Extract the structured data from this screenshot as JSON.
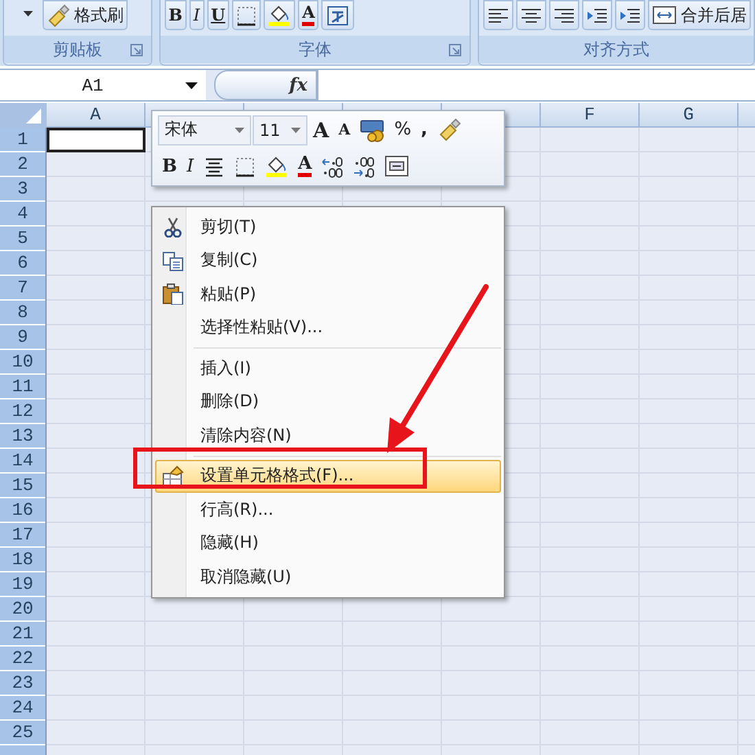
{
  "ribbon": {
    "groups": [
      {
        "label": "剪贴板",
        "buttons": [
          {
            "kind": "caret"
          },
          {
            "kind": "painter",
            "text": "格式刷"
          }
        ]
      },
      {
        "label": "字体",
        "buttons": [
          {
            "kind": "bold",
            "text": "B"
          },
          {
            "kind": "italic",
            "text": "I"
          },
          {
            "kind": "underline",
            "text": "U"
          },
          {
            "kind": "border"
          },
          {
            "kind": "fill"
          },
          {
            "kind": "fontcolor",
            "text": "A"
          },
          {
            "kind": "phonetic"
          }
        ]
      },
      {
        "label": "对齐方式",
        "buttons": [
          {
            "kind": "align_left"
          },
          {
            "kind": "align_center"
          },
          {
            "kind": "align_right"
          },
          {
            "kind": "outdent"
          },
          {
            "kind": "indent"
          },
          {
            "kind": "merge",
            "text": "合并后居"
          }
        ]
      }
    ]
  },
  "formula_bar": {
    "name_box": "A1",
    "function_label": "fx"
  },
  "sheet": {
    "columns": [
      "A",
      null,
      null,
      null,
      null,
      "F",
      "G"
    ],
    "rows": [
      {
        "label": "1",
        "active": true
      },
      {
        "label": "2",
        "active": false
      },
      {
        "label": "3",
        "active": false
      },
      {
        "label": "4",
        "active": false
      },
      {
        "label": "5",
        "active": false
      },
      {
        "label": "6",
        "active": false
      },
      {
        "label": "7",
        "active": false
      },
      {
        "label": "8",
        "active": false
      },
      {
        "label": "9",
        "active": false
      },
      {
        "label": "10",
        "active": false
      },
      {
        "label": "11",
        "active": false
      },
      {
        "label": "12",
        "active": false
      },
      {
        "label": "13",
        "active": false
      },
      {
        "label": "14",
        "active": false
      },
      {
        "label": "15",
        "active": false
      },
      {
        "label": "16",
        "active": false
      },
      {
        "label": "17",
        "active": false
      },
      {
        "label": "18",
        "active": false
      },
      {
        "label": "19",
        "active": false
      },
      {
        "label": "20",
        "active": false
      },
      {
        "label": "21",
        "active": false
      },
      {
        "label": "22",
        "active": false
      },
      {
        "label": "23",
        "active": false
      },
      {
        "label": "24",
        "active": false
      },
      {
        "label": "25",
        "active": false
      }
    ]
  },
  "mini_toolbar": {
    "font": "宋体",
    "size": "11",
    "row1": [
      {
        "kind": "grow",
        "text": "A"
      },
      {
        "kind": "shrink",
        "text": "A"
      },
      {
        "kind": "accounting"
      },
      {
        "kind": "percent",
        "text": "%"
      },
      {
        "kind": "comma",
        "text": ","
      },
      {
        "kind": "painter"
      }
    ],
    "row2": [
      {
        "kind": "bold",
        "text": "B"
      },
      {
        "kind": "italic",
        "text": "I"
      },
      {
        "kind": "center"
      },
      {
        "kind": "border"
      },
      {
        "kind": "fill"
      },
      {
        "kind": "fontcolor",
        "text": "A"
      },
      {
        "kind": "inc_decimal"
      },
      {
        "kind": "dec_decimal"
      },
      {
        "kind": "merge"
      }
    ]
  },
  "context_menu": {
    "groups": [
      [
        {
          "label": "剪切(T)",
          "kind": "scissors",
          "selected": false
        },
        {
          "label": "复制(C)",
          "kind": "copy",
          "selected": false
        },
        {
          "label": "粘贴(P)",
          "kind": "paste",
          "selected": false
        },
        {
          "label": "选择性粘贴(V)...",
          "kind": "plain",
          "selected": false
        }
      ],
      [
        {
          "label": "插入(I)",
          "kind": "plain",
          "selected": false
        },
        {
          "label": "删除(D)",
          "kind": "plain",
          "selected": false
        },
        {
          "label": "清除内容(N)",
          "kind": "plain",
          "selected": false
        }
      ],
      [
        {
          "label": "设置单元格格式(F)...",
          "kind": "format",
          "selected": true
        },
        {
          "label": "行高(R)...",
          "kind": "plain",
          "selected": false
        },
        {
          "label": "隐藏(H)",
          "kind": "plain",
          "selected": false
        },
        {
          "label": "取消隐藏(U)",
          "kind": "plain",
          "selected": false
        }
      ]
    ]
  }
}
